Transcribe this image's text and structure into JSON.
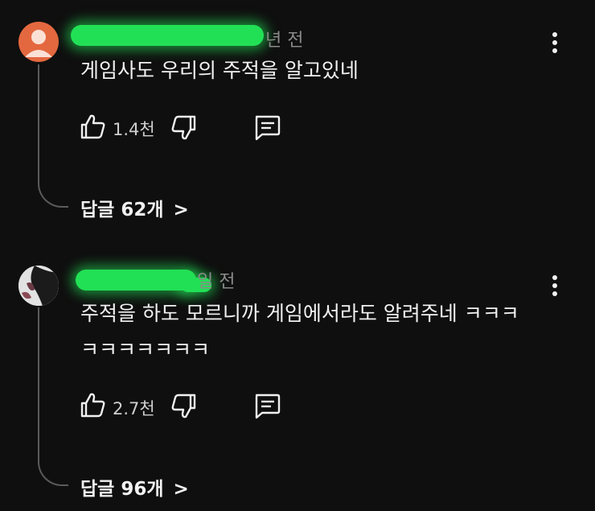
{
  "comments": [
    {
      "time_fragment": "년 전",
      "text_lines": [
        "게임사도 우리의 주적을 알고있네"
      ],
      "likes": "1.4천",
      "replies_label": "답글 62개",
      "reply_chevron": ">"
    },
    {
      "time_fragment": "일 전",
      "text_lines": [
        "주적을 하도 모르니까 게임에서라도 알려주네 ㅋㅋㅋ",
        "ㅋㅋㅋㅋㅋㅋㅋ"
      ],
      "likes": "2.7천",
      "replies_label": "답글 96개",
      "reply_chevron": ">"
    }
  ],
  "icons": {
    "like": "thumbs-up-icon",
    "dislike": "thumbs-down-icon",
    "reply": "comment-icon",
    "menu": "more-vert-icon"
  },
  "colors": {
    "background": "#0f0f0f",
    "text": "#f1f1f1",
    "redaction": "#22e055",
    "avatar_orange": "#e4683f"
  }
}
